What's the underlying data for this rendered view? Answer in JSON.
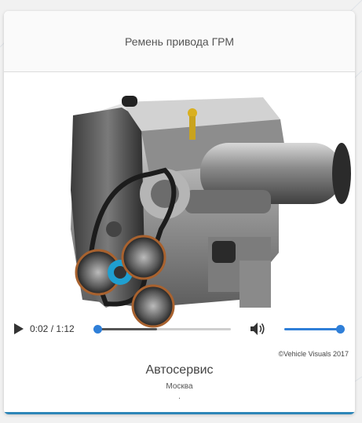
{
  "card": {
    "title": "Ремень привода ГРМ"
  },
  "player": {
    "current_time": "0:02",
    "duration": "1:12",
    "time_display": "0:02 / 1:12",
    "progress_fraction": 0.46,
    "played_fraction": 0.46,
    "knob_fraction": 0.03,
    "volume_fraction": 1.0,
    "icons": {
      "play": "play-icon",
      "volume": "volume-icon"
    },
    "accent_color": "#2f7fd8"
  },
  "copyright": "©Vehicle Visuals 2017",
  "footer": {
    "title": "Автосервис",
    "subtitle": "Москва",
    "extra": "."
  },
  "colors": {
    "bottom_bar": "#2e86b8"
  }
}
